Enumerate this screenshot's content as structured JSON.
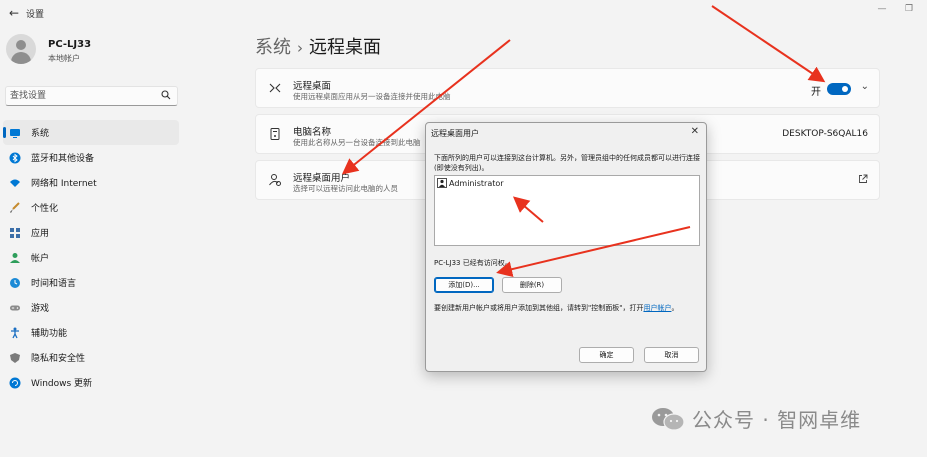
{
  "window": {
    "title": "设置",
    "minimize_glyph": "—",
    "restore_glyph": "❐"
  },
  "profile": {
    "name": "PC-LJ33",
    "account_type": "本地帐户"
  },
  "search": {
    "placeholder": "查找设置"
  },
  "sidebar": {
    "items": [
      {
        "label": "系统",
        "icon": "monitor-icon",
        "active": true
      },
      {
        "label": "蓝牙和其他设备",
        "icon": "bluetooth-icon"
      },
      {
        "label": "网络和 Internet",
        "icon": "wifi-icon"
      },
      {
        "label": "个性化",
        "icon": "brush-icon"
      },
      {
        "label": "应用",
        "icon": "apps-icon"
      },
      {
        "label": "帐户",
        "icon": "person-icon"
      },
      {
        "label": "时间和语言",
        "icon": "globe-clock-icon"
      },
      {
        "label": "游戏",
        "icon": "gamepad-icon"
      },
      {
        "label": "辅助功能",
        "icon": "accessibility-icon"
      },
      {
        "label": "隐私和安全性",
        "icon": "shield-icon"
      },
      {
        "label": "Windows 更新",
        "icon": "update-icon"
      }
    ]
  },
  "breadcrumb": {
    "parent": "系统",
    "separator": "›",
    "current": "远程桌面"
  },
  "cards": {
    "remote_desktop": {
      "title": "远程桌面",
      "desc": "使用远程桌面应用从另一设备连接并使用此电脑",
      "toggle_label": "开",
      "toggle_on": true
    },
    "pc_name": {
      "title": "电脑名称",
      "desc": "使用此名称从另一台设备连接到此电脑",
      "value": "DESKTOP-S6QAL16"
    },
    "remote_users": {
      "title": "远程桌面用户",
      "desc": "选择可以远程访问此电脑的人员"
    }
  },
  "dialog": {
    "title": "远程桌面用户",
    "close_glyph": "✕",
    "description": "下面所列的用户可以连接到这台计算机。另外，管理员组中的任何成员都可以进行连接(即使没有列出)。",
    "users": [
      "Administrator"
    ],
    "access_text": "PC-LJ33 已经有访问权。",
    "add_label": "添加(D)...",
    "remove_label": "删除(R)",
    "note_prefix": "要创建新用户帐户或将用户添加到其他组，请转到\"控制面板\"，打开",
    "note_link": "用户帐户",
    "note_suffix": "。",
    "ok_label": "确定",
    "cancel_label": "取消"
  },
  "watermark": {
    "text": "公众号 · 智网卓维"
  },
  "colors": {
    "accent": "#0067c0",
    "annotation_arrow": "#e8321e"
  }
}
